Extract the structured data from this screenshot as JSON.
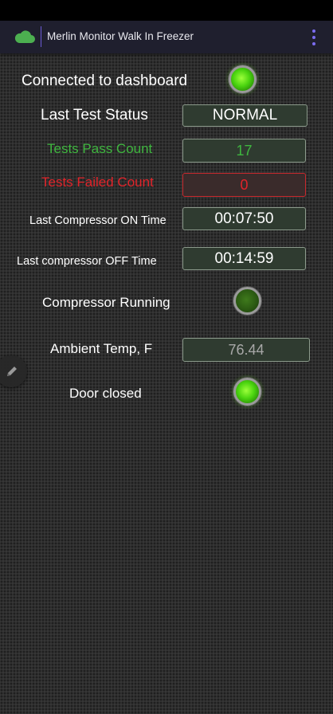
{
  "app_bar": {
    "title": "Merlin Monitor Walk In Freezer",
    "cloud_icon": "cloud-icon",
    "menu_icon": "more-vert-icon",
    "accent_color": "#4caf50",
    "divider_color": "#6b5bd6"
  },
  "rows": {
    "connected": {
      "label": "Connected to dashboard",
      "led_state": "on"
    },
    "last_test_status": {
      "label": "Last Test Status",
      "value": "NORMAL"
    },
    "tests_pass": {
      "label": "Tests Pass Count",
      "value": "17",
      "color": "#3fb63f"
    },
    "tests_failed": {
      "label": "Tests Failed Count",
      "value": "0",
      "color": "#e0242a"
    },
    "compressor_on_time": {
      "label": "Last Compressor ON Time",
      "value": "00:07:50"
    },
    "compressor_off_time": {
      "label": "Last compressor OFF Time",
      "value": "00:14:59"
    },
    "compressor_running": {
      "label": "Compressor Running",
      "led_state": "off"
    },
    "ambient_temp": {
      "label": "Ambient Temp, F",
      "value": "76.44"
    },
    "door_closed": {
      "label": "Door closed",
      "led_state": "on"
    }
  },
  "fab": {
    "icon": "pencil-icon"
  }
}
